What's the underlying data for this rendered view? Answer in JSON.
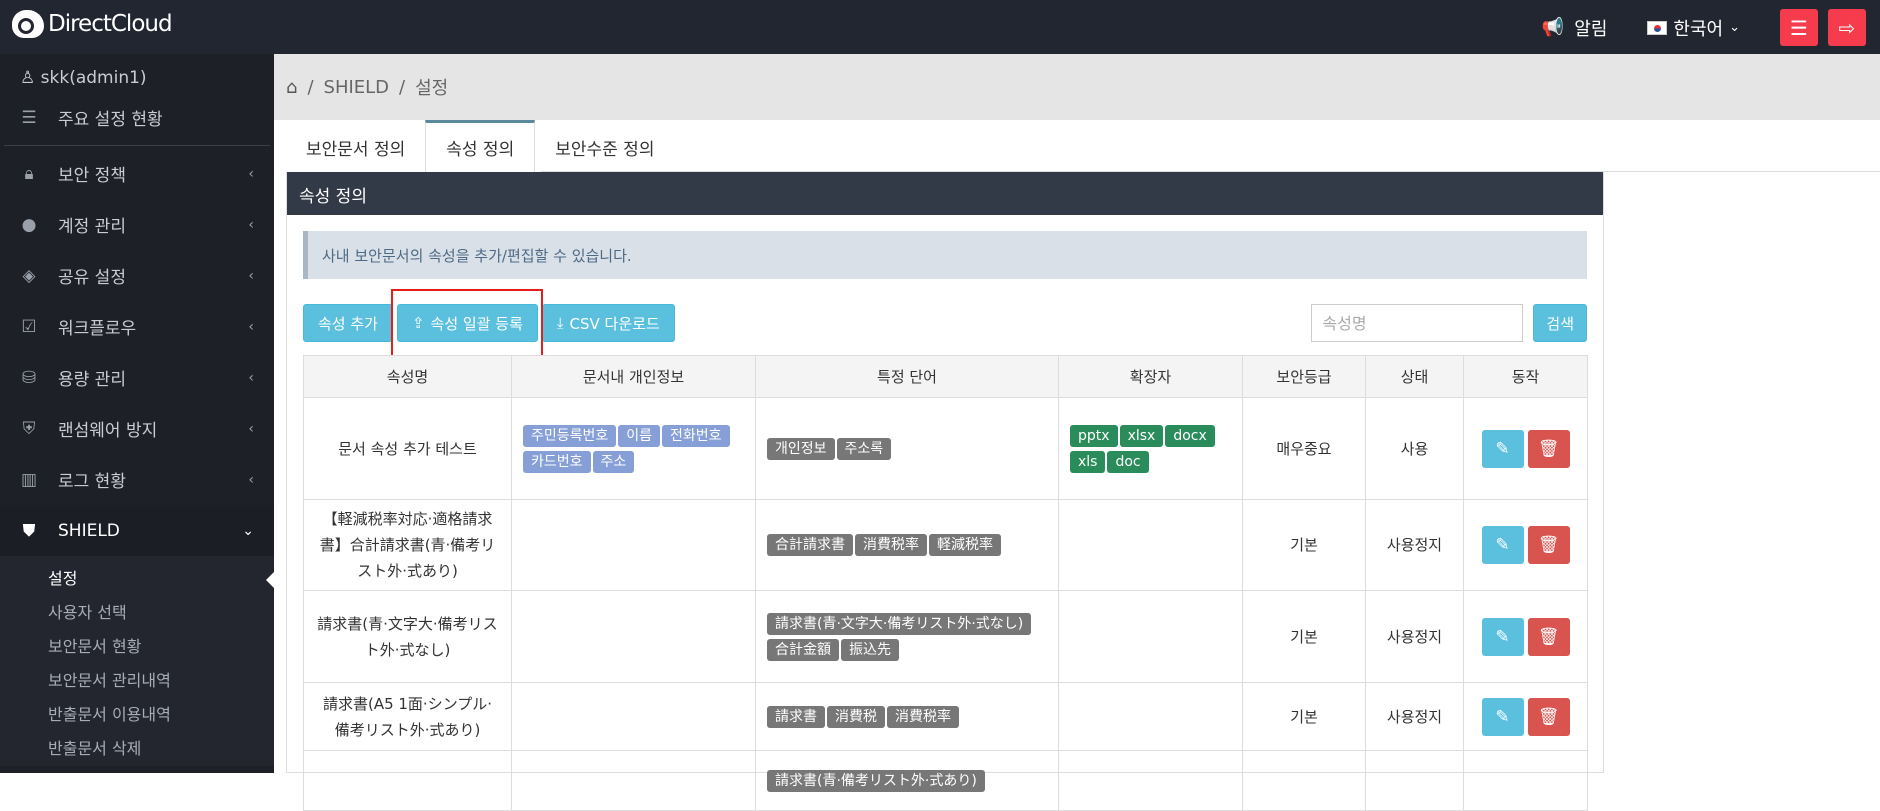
{
  "header": {
    "brand": "DirectCloud",
    "alarm": "알림",
    "language": "한국어"
  },
  "sidebar": {
    "user": "skk(admin1)",
    "items": [
      {
        "label": "주요 설정 현황",
        "icon": "list-icon"
      },
      {
        "label": "보안 정책",
        "icon": "lock-icon"
      },
      {
        "label": "계정 관리",
        "icon": "user-circle-icon"
      },
      {
        "label": "공유 설정",
        "icon": "share-icon"
      },
      {
        "label": "워크플로우",
        "icon": "check-square-icon"
      },
      {
        "label": "용량 관리",
        "icon": "database-icon"
      },
      {
        "label": "랜섬웨어 방지",
        "icon": "shield-check-icon"
      },
      {
        "label": "로그 현황",
        "icon": "bar-chart-icon"
      },
      {
        "label": "SHIELD",
        "icon": "shield-icon"
      }
    ],
    "sub": [
      "설정",
      "사용자 선택",
      "보안문서 현황",
      "보안문서 관리내역",
      "반출문서 이용내역",
      "반출문서 삭제"
    ]
  },
  "breadcrumb": [
    "SHIELD",
    "설정"
  ],
  "tabs": [
    "보안문서 정의",
    "속성 정의",
    "보안수준 정의"
  ],
  "panel": {
    "title": "속성 정의",
    "info": "사내 보안문서의 속성을 추가/편집할 수 있습니다.",
    "add": "속성 추가",
    "bulk": "속성 일괄 등록",
    "csv": "CSV 다운로드",
    "search_placeholder": "속성명",
    "search": "검색"
  },
  "table": {
    "headers": [
      "속성명",
      "문서내 개인정보",
      "특정 단어",
      "확장자",
      "보안등급",
      "상태",
      "동작"
    ],
    "rows": [
      {
        "name": "문서 속성 추가 테스트",
        "pii": [
          "주민등록번호",
          "이름",
          "전화번호",
          "카드번호",
          "주소"
        ],
        "words": [
          "개인정보",
          "주소록"
        ],
        "ext": [
          "pptx",
          "xlsx",
          "docx",
          "xls",
          "doc"
        ],
        "level": "매우중요",
        "status": "사용"
      },
      {
        "name": "【軽減税率対応·適格請求書】合計請求書(青·備考リスト外·式あり)",
        "pii": [],
        "words": [
          "合計請求書",
          "消費税率",
          "軽減税率"
        ],
        "ext": [],
        "level": "기본",
        "status": "사용정지"
      },
      {
        "name": "請求書(青·文字大·備考リスト外·式なし)",
        "pii": [],
        "words": [
          "請求書(青·文字大·備考リスト外·式なし)",
          "合計金額",
          "振込先"
        ],
        "ext": [],
        "level": "기본",
        "status": "사용정지"
      },
      {
        "name": "請求書(A5 1面·シンプル·備考リスト外·式あり)",
        "pii": [],
        "words": [
          "請求書",
          "消費税",
          "消費税率"
        ],
        "ext": [],
        "level": "기본",
        "status": "사용정지"
      },
      {
        "name": "",
        "pii": [],
        "words": [
          "請求書(青·備考リスト外·式あり)"
        ],
        "ext": [],
        "level": "",
        "status": ""
      }
    ]
  }
}
